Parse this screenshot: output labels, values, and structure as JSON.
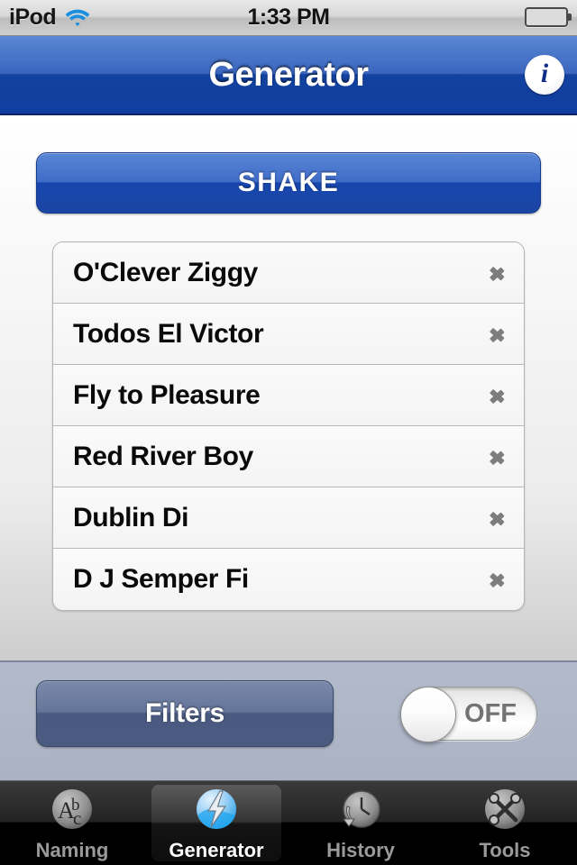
{
  "status_bar": {
    "carrier": "iPod",
    "wifi_icon": "wifi-icon",
    "time": "1:33 PM",
    "battery_icon": "battery-full-icon"
  },
  "nav_bar": {
    "title": "Generator",
    "info_button": "i",
    "info_icon": "info-circle-icon",
    "accent_color": "#1746ad"
  },
  "main": {
    "shake_button": "SHAKE",
    "names": [
      {
        "label": "O'Clever Ziggy"
      },
      {
        "label": "Todos El Victor"
      },
      {
        "label": "Fly to Pleasure"
      },
      {
        "label": "Red River Boy"
      },
      {
        "label": "Dublin Di"
      },
      {
        "label": "D J Semper Fi"
      }
    ],
    "chevron_icon": "chevron-right-icon"
  },
  "bottom_bar": {
    "filters_button": "Filters",
    "toggle_state": "OFF"
  },
  "tab_bar": {
    "tabs": [
      {
        "label": "Naming",
        "icon": "abc-circle-icon",
        "selected": false
      },
      {
        "label": "Generator",
        "icon": "lightning-bolt-icon",
        "selected": true
      },
      {
        "label": "History",
        "icon": "clock-arrow-icon",
        "selected": false
      },
      {
        "label": "Tools",
        "icon": "hammer-wrench-icon",
        "selected": false
      }
    ]
  }
}
